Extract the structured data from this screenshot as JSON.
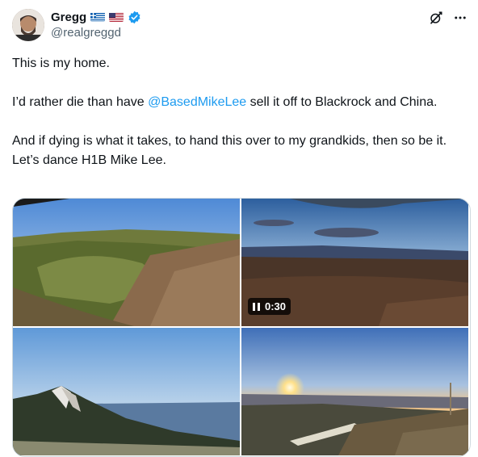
{
  "author": {
    "name": "Gregg",
    "handle": "@realgreggd",
    "flags": [
      "greek-flag",
      "us-flag"
    ],
    "verified": true,
    "verified_color": "#1d9bf0"
  },
  "actions": {
    "grok_icon": "grok-icon",
    "more_icon": "more-dots-icon",
    "more_label": "···"
  },
  "tweet": {
    "line1": "This is my home.",
    "line2_before": "I’d rather die than have ",
    "mention": "@BasedMikeLee",
    "line2_after": " sell it off to Blackrock and China.",
    "line3": "And if dying is what it takes, to hand this over to my grandkids, then so be it. Let’s dance H1B Mike Lee.",
    "mention_color": "#1d9bf0"
  },
  "media": {
    "count": 4,
    "video_duration": "0:30",
    "tiles": [
      "canyon-landscape-photo",
      "sunset-video-thumbnail",
      "mountain-photo",
      "sunrise-ridge-photo"
    ]
  }
}
